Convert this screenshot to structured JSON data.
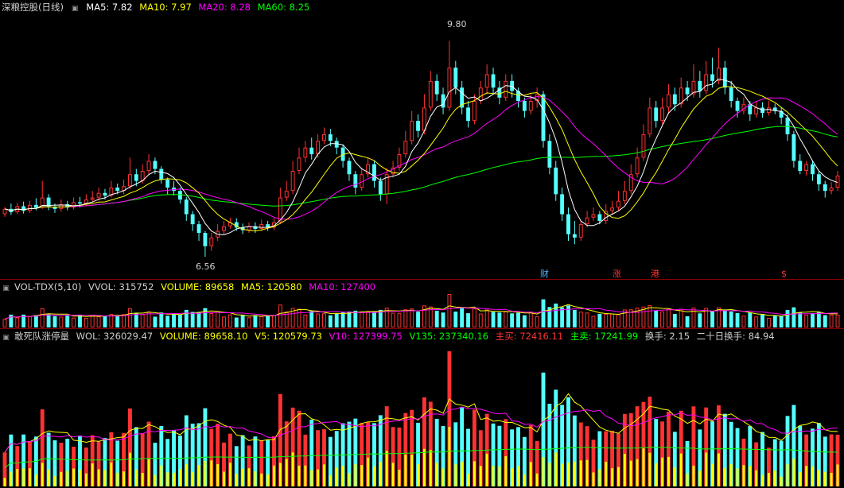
{
  "colors": {
    "up": "#ff3232",
    "down": "#54ffff",
    "ma5": "#ffffff",
    "ma10": "#ffff00",
    "ma20": "#ff00ff",
    "ma60": "#00ff00",
    "volume": "#ffff00",
    "v135": "#00ff00",
    "main_buy": "#ff3232",
    "main_sell": "#00ff00",
    "neutral": "#cccccc"
  },
  "price_panel": {
    "stock_name": "深粮控股",
    "period": "(日线)",
    "toggle_icon": "collapse-icon",
    "indicators": [
      {
        "label": "MA5: 7.82",
        "color": "#ffffff"
      },
      {
        "label": "MA10: 7.97",
        "color": "#ffff00"
      },
      {
        "label": "MA20: 8.28",
        "color": "#ff00ff"
      },
      {
        "label": "MA60: 8.25",
        "color": "#00ff00"
      }
    ],
    "high_label": "9.80",
    "low_label": "6.56",
    "markers": [
      {
        "text": "财",
        "color": "#54b4ff"
      },
      {
        "text": "涨",
        "color": "#ff3232"
      },
      {
        "text": "港",
        "color": "#ff3232"
      },
      {
        "text": "$",
        "color": "#ff3232"
      }
    ]
  },
  "vol_panel": {
    "title": "VOL-TDX(5,10)",
    "values": [
      {
        "label": "VVOL: 315752",
        "color": "#cccccc"
      },
      {
        "label": "VOLUME: 89658",
        "color": "#ffff00"
      },
      {
        "label": "MA5: 120580",
        "color": "#ffff00"
      },
      {
        "label": "MA10: 127400",
        "color": "#ff00ff"
      }
    ]
  },
  "dare_panel": {
    "title": "敢死队涨停量",
    "values": [
      {
        "label": "WOL: 326029.47",
        "color": "#cccccc"
      },
      {
        "label": "VOLUME: 89658.10",
        "color": "#ffff00"
      },
      {
        "label": "V5: 120579.73",
        "color": "#ffff00"
      },
      {
        "label": "V10: 127399.75",
        "color": "#ff00ff"
      },
      {
        "label": "V135: 237340.16",
        "color": "#00ff00"
      },
      {
        "label": "主买: 72416.11",
        "color": "#ff3232"
      },
      {
        "label": "主卖: 17241.99",
        "color": "#00ff00"
      },
      {
        "label": "换手: 2.15",
        "color": "#cccccc"
      },
      {
        "label": "二十日换手: 84.94",
        "color": "#cccccc"
      }
    ]
  },
  "chart_data": {
    "type": "candlestick",
    "period": "daily",
    "ylim": [
      6.3,
      10.2
    ],
    "candles": [
      [
        7.2,
        7.28,
        7.31,
        7.16
      ],
      [
        7.28,
        7.23,
        7.36,
        7.19
      ],
      [
        7.23,
        7.32,
        7.37,
        7.2
      ],
      [
        7.32,
        7.25,
        7.39,
        7.21
      ],
      [
        7.25,
        7.34,
        7.4,
        7.22
      ],
      [
        7.34,
        7.3,
        7.44,
        7.26
      ],
      [
        7.3,
        7.45,
        7.7,
        7.28
      ],
      [
        7.45,
        7.31,
        7.5,
        7.26
      ],
      [
        7.31,
        7.28,
        7.36,
        7.22
      ],
      [
        7.28,
        7.35,
        7.42,
        7.24
      ],
      [
        7.35,
        7.3,
        7.4,
        7.26
      ],
      [
        7.3,
        7.38,
        7.45,
        7.27
      ],
      [
        7.38,
        7.36,
        7.46,
        7.3
      ],
      [
        7.36,
        7.42,
        7.5,
        7.32
      ],
      [
        7.42,
        7.45,
        7.55,
        7.38
      ],
      [
        7.45,
        7.52,
        7.6,
        7.4
      ],
      [
        7.52,
        7.48,
        7.58,
        7.42
      ],
      [
        7.48,
        7.6,
        7.7,
        7.45
      ],
      [
        7.6,
        7.55,
        7.66,
        7.5
      ],
      [
        7.55,
        7.62,
        7.72,
        7.5
      ],
      [
        7.62,
        7.8,
        8.05,
        7.58
      ],
      [
        7.8,
        7.7,
        7.88,
        7.62
      ],
      [
        7.7,
        7.85,
        7.95,
        7.66
      ],
      [
        7.85,
        8.0,
        8.1,
        7.8
      ],
      [
        8.0,
        7.88,
        8.05,
        7.8
      ],
      [
        7.88,
        7.72,
        7.92,
        7.66
      ],
      [
        7.72,
        7.6,
        7.75,
        7.5
      ],
      [
        7.6,
        7.55,
        7.7,
        7.48
      ],
      [
        7.55,
        7.42,
        7.6,
        7.36
      ],
      [
        7.42,
        7.2,
        7.46,
        7.1
      ],
      [
        7.2,
        7.05,
        7.25,
        6.95
      ],
      [
        7.05,
        6.92,
        7.1,
        6.8
      ],
      [
        6.92,
        6.72,
        6.95,
        6.56
      ],
      [
        6.72,
        6.85,
        6.92,
        6.65
      ],
      [
        6.85,
        6.95,
        7.05,
        6.8
      ],
      [
        6.95,
        7.02,
        7.1,
        6.9
      ],
      [
        7.02,
        7.08,
        7.15,
        6.98
      ],
      [
        7.08,
        7.0,
        7.14,
        6.95
      ],
      [
        7.0,
        6.96,
        7.06,
        6.9
      ],
      [
        6.96,
        7.02,
        7.08,
        6.92
      ],
      [
        7.02,
        6.98,
        7.08,
        6.92
      ],
      [
        6.98,
        7.05,
        7.12,
        6.95
      ],
      [
        7.05,
        7.0,
        7.1,
        6.95
      ],
      [
        7.0,
        7.08,
        7.14,
        6.96
      ],
      [
        7.08,
        7.45,
        7.6,
        7.05
      ],
      [
        7.45,
        7.55,
        7.7,
        7.4
      ],
      [
        7.55,
        7.85,
        8.0,
        7.5
      ],
      [
        7.85,
        8.05,
        8.2,
        7.8
      ],
      [
        8.05,
        8.2,
        8.3,
        7.98
      ],
      [
        8.2,
        8.1,
        8.35,
        8.02
      ],
      [
        8.1,
        8.3,
        8.4,
        8.05
      ],
      [
        8.3,
        8.4,
        8.5,
        8.25
      ],
      [
        8.4,
        8.3,
        8.48,
        8.22
      ],
      [
        8.3,
        8.2,
        8.35,
        8.1
      ],
      [
        8.2,
        8.0,
        8.25,
        7.9
      ],
      [
        8.0,
        7.8,
        8.05,
        7.7
      ],
      [
        7.8,
        7.6,
        7.85,
        7.5
      ],
      [
        7.6,
        7.8,
        7.9,
        7.55
      ],
      [
        7.8,
        7.95,
        8.05,
        7.75
      ],
      [
        7.95,
        7.7,
        8.0,
        7.6
      ],
      [
        7.7,
        7.5,
        7.75,
        7.4
      ],
      [
        7.5,
        7.8,
        7.9,
        7.35
      ],
      [
        7.8,
        7.9,
        8.0,
        7.75
      ],
      [
        7.9,
        8.1,
        8.2,
        7.85
      ],
      [
        8.1,
        8.3,
        8.45,
        8.05
      ],
      [
        8.3,
        8.6,
        8.75,
        8.25
      ],
      [
        8.6,
        8.45,
        8.7,
        8.35
      ],
      [
        8.45,
        8.8,
        9.0,
        8.4
      ],
      [
        8.8,
        9.2,
        9.35,
        8.75
      ],
      [
        9.2,
        9.0,
        9.3,
        8.9
      ],
      [
        9.0,
        8.8,
        9.1,
        8.7
      ],
      [
        8.8,
        9.4,
        9.8,
        8.75
      ],
      [
        9.4,
        9.1,
        9.5,
        9.0
      ],
      [
        9.1,
        8.8,
        9.2,
        8.7
      ],
      [
        8.8,
        8.6,
        8.9,
        8.5
      ],
      [
        8.6,
        8.9,
        9.0,
        8.55
      ],
      [
        8.9,
        9.1,
        9.2,
        8.85
      ],
      [
        9.1,
        9.3,
        9.45,
        9.0
      ],
      [
        9.3,
        9.1,
        9.4,
        9.0
      ],
      [
        9.1,
        8.95,
        9.2,
        8.85
      ],
      [
        8.95,
        9.2,
        9.3,
        8.9
      ],
      [
        9.2,
        9.05,
        9.3,
        8.95
      ],
      [
        9.05,
        8.9,
        9.1,
        8.8
      ],
      [
        8.9,
        8.75,
        8.95,
        8.65
      ],
      [
        8.75,
        8.9,
        9.0,
        8.7
      ],
      [
        8.9,
        9.0,
        9.1,
        8.8
      ],
      [
        9.0,
        8.3,
        9.05,
        8.2
      ],
      [
        8.3,
        7.9,
        8.4,
        7.8
      ],
      [
        7.9,
        7.5,
        8.0,
        7.4
      ],
      [
        7.5,
        7.2,
        7.6,
        7.1
      ],
      [
        7.2,
        6.9,
        7.3,
        6.8
      ],
      [
        6.9,
        6.85,
        7.1,
        6.75
      ],
      [
        6.85,
        7.05,
        7.1,
        6.8
      ],
      [
        7.05,
        7.15,
        7.25,
        7.0
      ],
      [
        7.15,
        7.2,
        7.3,
        7.1
      ],
      [
        7.2,
        7.1,
        7.25,
        7.05
      ],
      [
        7.1,
        7.25,
        7.35,
        7.05
      ],
      [
        7.25,
        7.3,
        7.4,
        7.2
      ],
      [
        7.3,
        7.4,
        7.55,
        7.25
      ],
      [
        7.4,
        7.55,
        7.7,
        7.35
      ],
      [
        7.55,
        7.8,
        7.95,
        7.5
      ],
      [
        7.8,
        8.05,
        8.2,
        7.75
      ],
      [
        8.05,
        8.4,
        8.55,
        8.0
      ],
      [
        8.4,
        8.8,
        8.95,
        8.35
      ],
      [
        8.8,
        8.6,
        8.9,
        8.5
      ],
      [
        8.6,
        8.8,
        8.95,
        8.55
      ],
      [
        8.8,
        9.0,
        9.15,
        8.7
      ],
      [
        9.0,
        8.85,
        9.1,
        8.75
      ],
      [
        8.85,
        9.1,
        9.25,
        8.8
      ],
      [
        9.1,
        9.0,
        9.2,
        8.9
      ],
      [
        9.0,
        9.2,
        9.45,
        8.95
      ],
      [
        9.2,
        9.05,
        9.35,
        8.95
      ],
      [
        9.05,
        9.3,
        9.5,
        9.0
      ],
      [
        9.3,
        9.2,
        9.55,
        9.1
      ],
      [
        9.2,
        9.4,
        9.7,
        9.15
      ],
      [
        9.4,
        9.1,
        9.5,
        9.0
      ],
      [
        9.1,
        8.9,
        9.2,
        8.8
      ],
      [
        8.9,
        8.75,
        8.95,
        8.65
      ],
      [
        8.75,
        8.85,
        8.95,
        8.7
      ],
      [
        8.85,
        8.7,
        8.9,
        8.6
      ],
      [
        8.7,
        8.8,
        8.9,
        8.65
      ],
      [
        8.8,
        8.72,
        8.88,
        8.65
      ],
      [
        8.72,
        8.8,
        8.9,
        8.68
      ],
      [
        8.8,
        8.75,
        8.86,
        8.7
      ],
      [
        8.75,
        8.65,
        8.8,
        8.55
      ],
      [
        8.65,
        8.4,
        8.7,
        8.3
      ],
      [
        8.4,
        8.0,
        8.45,
        7.9
      ],
      [
        8.0,
        7.85,
        8.1,
        7.8
      ],
      [
        7.85,
        7.95,
        8.0,
        7.78
      ],
      [
        7.95,
        7.8,
        8.0,
        7.7
      ],
      [
        7.8,
        7.65,
        7.85,
        7.55
      ],
      [
        7.65,
        7.55,
        7.7,
        7.45
      ],
      [
        7.55,
        7.6,
        7.68,
        7.5
      ],
      [
        7.6,
        7.78,
        7.85,
        7.55
      ]
    ]
  }
}
